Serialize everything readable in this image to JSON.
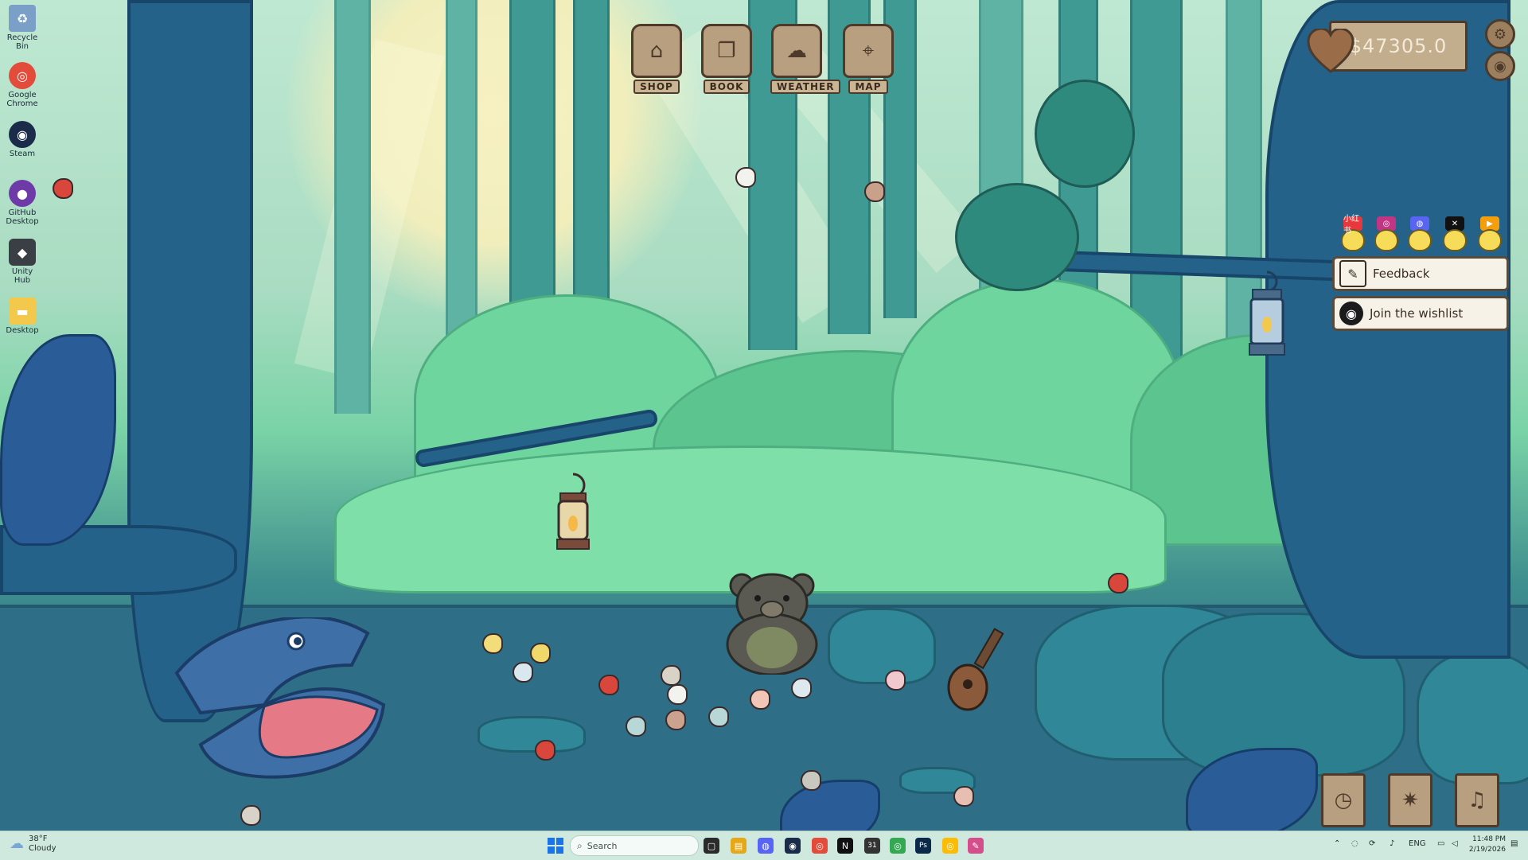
{
  "desktop_icons": [
    {
      "label": "Recycle Bin",
      "icon": "recycle-bin-icon",
      "color": "#7aa0c8"
    },
    {
      "label": "Google Chrome",
      "icon": "chrome-icon",
      "color": "#e34b3b"
    },
    {
      "label": "Steam",
      "icon": "steam-icon",
      "color": "#1b2c4a"
    },
    {
      "label": "GitHub Desktop",
      "icon": "github-icon",
      "color": "#6e3aa8"
    },
    {
      "label": "Unity Hub",
      "icon": "unity-icon",
      "color": "#3a3f46"
    },
    {
      "label": "Desktop",
      "icon": "folder-icon",
      "color": "#f2c94c"
    }
  ],
  "top_menu": [
    {
      "label": "SHOP",
      "icon": "shop-house-icon",
      "glyph": "⌂"
    },
    {
      "label": "BOOK",
      "icon": "book-icon",
      "glyph": "❐"
    },
    {
      "label": "WEATHER",
      "icon": "weather-icon",
      "glyph": "☁"
    },
    {
      "label": "MAP",
      "icon": "map-icon",
      "glyph": "⌖"
    }
  ],
  "money": {
    "value": "$47305.0",
    "icon": "heart-icon"
  },
  "corner_buttons": [
    {
      "icon": "settings-gear-icon",
      "glyph": "⚙"
    },
    {
      "icon": "eye-icon",
      "glyph": "◉"
    }
  ],
  "social_links": [
    {
      "icon": "rednote-icon",
      "text": "小红书",
      "color": "#e8383d"
    },
    {
      "icon": "instagram-icon",
      "text": "◎",
      "color": "#c13584"
    },
    {
      "icon": "discord-icon",
      "text": "◍",
      "color": "#5865f2"
    },
    {
      "icon": "x-icon",
      "text": "✕",
      "color": "#111111"
    },
    {
      "icon": "bilibili-icon",
      "text": "▶",
      "color": "#f59e0b"
    }
  ],
  "side_buttons": {
    "feedback": {
      "label": "Feedback",
      "icon": "feedback-notepad-icon"
    },
    "wishlist": {
      "label": "Join the wishlist",
      "icon": "steam-icon"
    }
  },
  "bottom_tools": [
    {
      "icon": "compass-clock-icon",
      "glyph": "◷"
    },
    {
      "icon": "lightbulb-icon",
      "glyph": "✷"
    },
    {
      "icon": "music-note-icon",
      "glyph": "♫"
    }
  ],
  "taskbar": {
    "weather_temp": "38°F",
    "weather_desc": "Cloudy",
    "search_placeholder": "Search",
    "apps": [
      {
        "icon": "task-view-icon",
        "glyph": "▢",
        "color": "#2b2b2b"
      },
      {
        "icon": "file-explorer-icon",
        "glyph": "▤",
        "color": "#e6a817"
      },
      {
        "icon": "discord-icon",
        "glyph": "◍",
        "color": "#5865f2"
      },
      {
        "icon": "steam-icon",
        "glyph": "◉",
        "color": "#1b2c4a"
      },
      {
        "icon": "chrome-icon",
        "glyph": "◎",
        "color": "#e34b3b"
      },
      {
        "icon": "notion-icon",
        "glyph": "N",
        "color": "#111111"
      },
      {
        "icon": "calendar-icon",
        "glyph": "31",
        "color": "#333333"
      },
      {
        "icon": "chrome-profile-icon",
        "glyph": "◎",
        "color": "#34a853"
      },
      {
        "icon": "photoshop-icon",
        "glyph": "Ps",
        "color": "#0b2a4a"
      },
      {
        "icon": "chrome-alt-icon",
        "glyph": "◎",
        "color": "#fbbc05"
      },
      {
        "icon": "paint-icon",
        "glyph": "✎",
        "color": "#d64d8b"
      }
    ],
    "tray": {
      "language": "ENG",
      "time": "11:48 PM",
      "date": "2/19/2026"
    }
  }
}
